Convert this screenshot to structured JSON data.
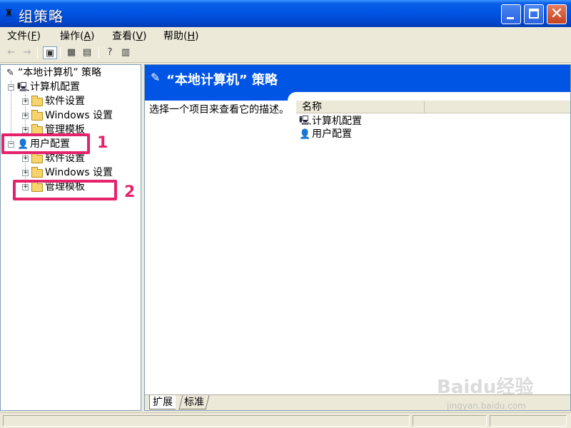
{
  "window": {
    "title": "组策略",
    "minimize_label": "–",
    "maximize_label": "",
    "close_label": "✕"
  },
  "menu": {
    "items": [
      {
        "label": "文件",
        "accel": "F"
      },
      {
        "label": "操作",
        "accel": "A"
      },
      {
        "label": "查看",
        "accel": "V"
      },
      {
        "label": "帮助",
        "accel": "H"
      }
    ]
  },
  "toolbar": {
    "back_icon": "←",
    "forward_icon": "→",
    "show_tree_icon": "▣",
    "properties_icon": "▦",
    "export_icon": "▤",
    "help_icon": "?",
    "console_icon": "▥"
  },
  "tree": {
    "root": "“本地计算机” 策略",
    "computer_config": "计算机配置",
    "software_settings_1": "软件设置",
    "windows_settings_1": "Windows 设置",
    "admin_templates_1": "管理模板",
    "user_config": "用户配置",
    "software_settings_2": "软件设置",
    "windows_settings_2": "Windows 设置",
    "admin_templates_2": "管理模板"
  },
  "right_pane": {
    "header_title": "“本地计算机” 策略",
    "description": "选择一个项目来查看它的描述。",
    "column_name": "名称",
    "items": [
      {
        "label": "计算机配置",
        "icon": "computer-icon"
      },
      {
        "label": "用户配置",
        "icon": "user-icon"
      }
    ]
  },
  "tabs": {
    "extended": "扩展",
    "standard": "标准"
  },
  "annotations": {
    "step1": "1",
    "step2": "2"
  },
  "watermark": {
    "brand": "Baidu经验",
    "url": "jingyan.baidu.com"
  },
  "colors": {
    "titlebar": "#0054e3",
    "header_band": "#0055e5",
    "annotation": "#e5236b"
  }
}
